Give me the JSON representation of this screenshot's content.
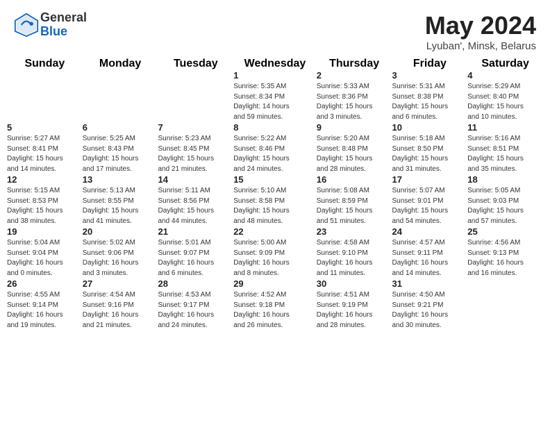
{
  "header": {
    "logo_general": "General",
    "logo_blue": "Blue",
    "month": "May 2024",
    "location": "Lyuban', Minsk, Belarus"
  },
  "weekdays": [
    "Sunday",
    "Monday",
    "Tuesday",
    "Wednesday",
    "Thursday",
    "Friday",
    "Saturday"
  ],
  "weeks": [
    [
      {
        "day": "",
        "info": ""
      },
      {
        "day": "",
        "info": ""
      },
      {
        "day": "",
        "info": ""
      },
      {
        "day": "1",
        "info": "Sunrise: 5:35 AM\nSunset: 8:34 PM\nDaylight: 14 hours\nand 59 minutes."
      },
      {
        "day": "2",
        "info": "Sunrise: 5:33 AM\nSunset: 8:36 PM\nDaylight: 15 hours\nand 3 minutes."
      },
      {
        "day": "3",
        "info": "Sunrise: 5:31 AM\nSunset: 8:38 PM\nDaylight: 15 hours\nand 6 minutes."
      },
      {
        "day": "4",
        "info": "Sunrise: 5:29 AM\nSunset: 8:40 PM\nDaylight: 15 hours\nand 10 minutes."
      }
    ],
    [
      {
        "day": "5",
        "info": "Sunrise: 5:27 AM\nSunset: 8:41 PM\nDaylight: 15 hours\nand 14 minutes."
      },
      {
        "day": "6",
        "info": "Sunrise: 5:25 AM\nSunset: 8:43 PM\nDaylight: 15 hours\nand 17 minutes."
      },
      {
        "day": "7",
        "info": "Sunrise: 5:23 AM\nSunset: 8:45 PM\nDaylight: 15 hours\nand 21 minutes."
      },
      {
        "day": "8",
        "info": "Sunrise: 5:22 AM\nSunset: 8:46 PM\nDaylight: 15 hours\nand 24 minutes."
      },
      {
        "day": "9",
        "info": "Sunrise: 5:20 AM\nSunset: 8:48 PM\nDaylight: 15 hours\nand 28 minutes."
      },
      {
        "day": "10",
        "info": "Sunrise: 5:18 AM\nSunset: 8:50 PM\nDaylight: 15 hours\nand 31 minutes."
      },
      {
        "day": "11",
        "info": "Sunrise: 5:16 AM\nSunset: 8:51 PM\nDaylight: 15 hours\nand 35 minutes."
      }
    ],
    [
      {
        "day": "12",
        "info": "Sunrise: 5:15 AM\nSunset: 8:53 PM\nDaylight: 15 hours\nand 38 minutes."
      },
      {
        "day": "13",
        "info": "Sunrise: 5:13 AM\nSunset: 8:55 PM\nDaylight: 15 hours\nand 41 minutes."
      },
      {
        "day": "14",
        "info": "Sunrise: 5:11 AM\nSunset: 8:56 PM\nDaylight: 15 hours\nand 44 minutes."
      },
      {
        "day": "15",
        "info": "Sunrise: 5:10 AM\nSunset: 8:58 PM\nDaylight: 15 hours\nand 48 minutes."
      },
      {
        "day": "16",
        "info": "Sunrise: 5:08 AM\nSunset: 8:59 PM\nDaylight: 15 hours\nand 51 minutes."
      },
      {
        "day": "17",
        "info": "Sunrise: 5:07 AM\nSunset: 9:01 PM\nDaylight: 15 hours\nand 54 minutes."
      },
      {
        "day": "18",
        "info": "Sunrise: 5:05 AM\nSunset: 9:03 PM\nDaylight: 15 hours\nand 57 minutes."
      }
    ],
    [
      {
        "day": "19",
        "info": "Sunrise: 5:04 AM\nSunset: 9:04 PM\nDaylight: 16 hours\nand 0 minutes."
      },
      {
        "day": "20",
        "info": "Sunrise: 5:02 AM\nSunset: 9:06 PM\nDaylight: 16 hours\nand 3 minutes."
      },
      {
        "day": "21",
        "info": "Sunrise: 5:01 AM\nSunset: 9:07 PM\nDaylight: 16 hours\nand 6 minutes."
      },
      {
        "day": "22",
        "info": "Sunrise: 5:00 AM\nSunset: 9:09 PM\nDaylight: 16 hours\nand 8 minutes."
      },
      {
        "day": "23",
        "info": "Sunrise: 4:58 AM\nSunset: 9:10 PM\nDaylight: 16 hours\nand 11 minutes."
      },
      {
        "day": "24",
        "info": "Sunrise: 4:57 AM\nSunset: 9:11 PM\nDaylight: 16 hours\nand 14 minutes."
      },
      {
        "day": "25",
        "info": "Sunrise: 4:56 AM\nSunset: 9:13 PM\nDaylight: 16 hours\nand 16 minutes."
      }
    ],
    [
      {
        "day": "26",
        "info": "Sunrise: 4:55 AM\nSunset: 9:14 PM\nDaylight: 16 hours\nand 19 minutes."
      },
      {
        "day": "27",
        "info": "Sunrise: 4:54 AM\nSunset: 9:16 PM\nDaylight: 16 hours\nand 21 minutes."
      },
      {
        "day": "28",
        "info": "Sunrise: 4:53 AM\nSunset: 9:17 PM\nDaylight: 16 hours\nand 24 minutes."
      },
      {
        "day": "29",
        "info": "Sunrise: 4:52 AM\nSunset: 9:18 PM\nDaylight: 16 hours\nand 26 minutes."
      },
      {
        "day": "30",
        "info": "Sunrise: 4:51 AM\nSunset: 9:19 PM\nDaylight: 16 hours\nand 28 minutes."
      },
      {
        "day": "31",
        "info": "Sunrise: 4:50 AM\nSunset: 9:21 PM\nDaylight: 16 hours\nand 30 minutes."
      },
      {
        "day": "",
        "info": ""
      }
    ]
  ]
}
